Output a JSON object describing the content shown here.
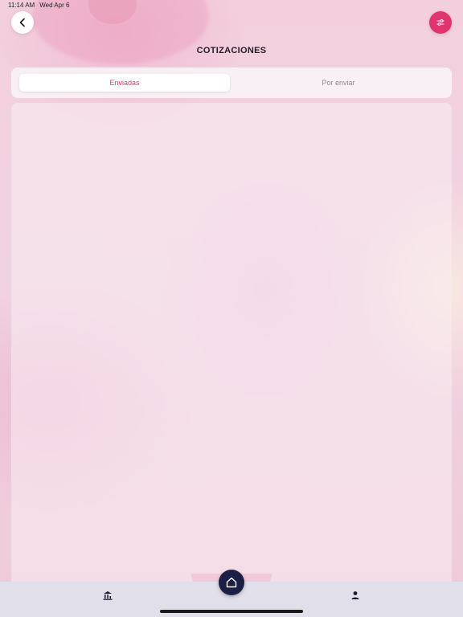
{
  "status_bar": {
    "time": "11:14 AM",
    "date": "Wed Apr 6"
  },
  "header": {
    "title": "COTIZACIONES",
    "back_icon": "chevron-left-icon",
    "filter_icon": "sliders-icon"
  },
  "tabs": [
    {
      "label": "Enviadas",
      "active": true
    },
    {
      "label": "Por enviar",
      "active": false
    }
  ],
  "bottom_nav": {
    "items": [
      {
        "icon": "bank-chart-icon"
      },
      {
        "icon": "home-icon"
      },
      {
        "icon": "person-icon"
      }
    ]
  },
  "colors": {
    "accent": "#e3336f",
    "nav_dark": "#1b1f45",
    "bottom_bar": "#e1dfe9"
  }
}
